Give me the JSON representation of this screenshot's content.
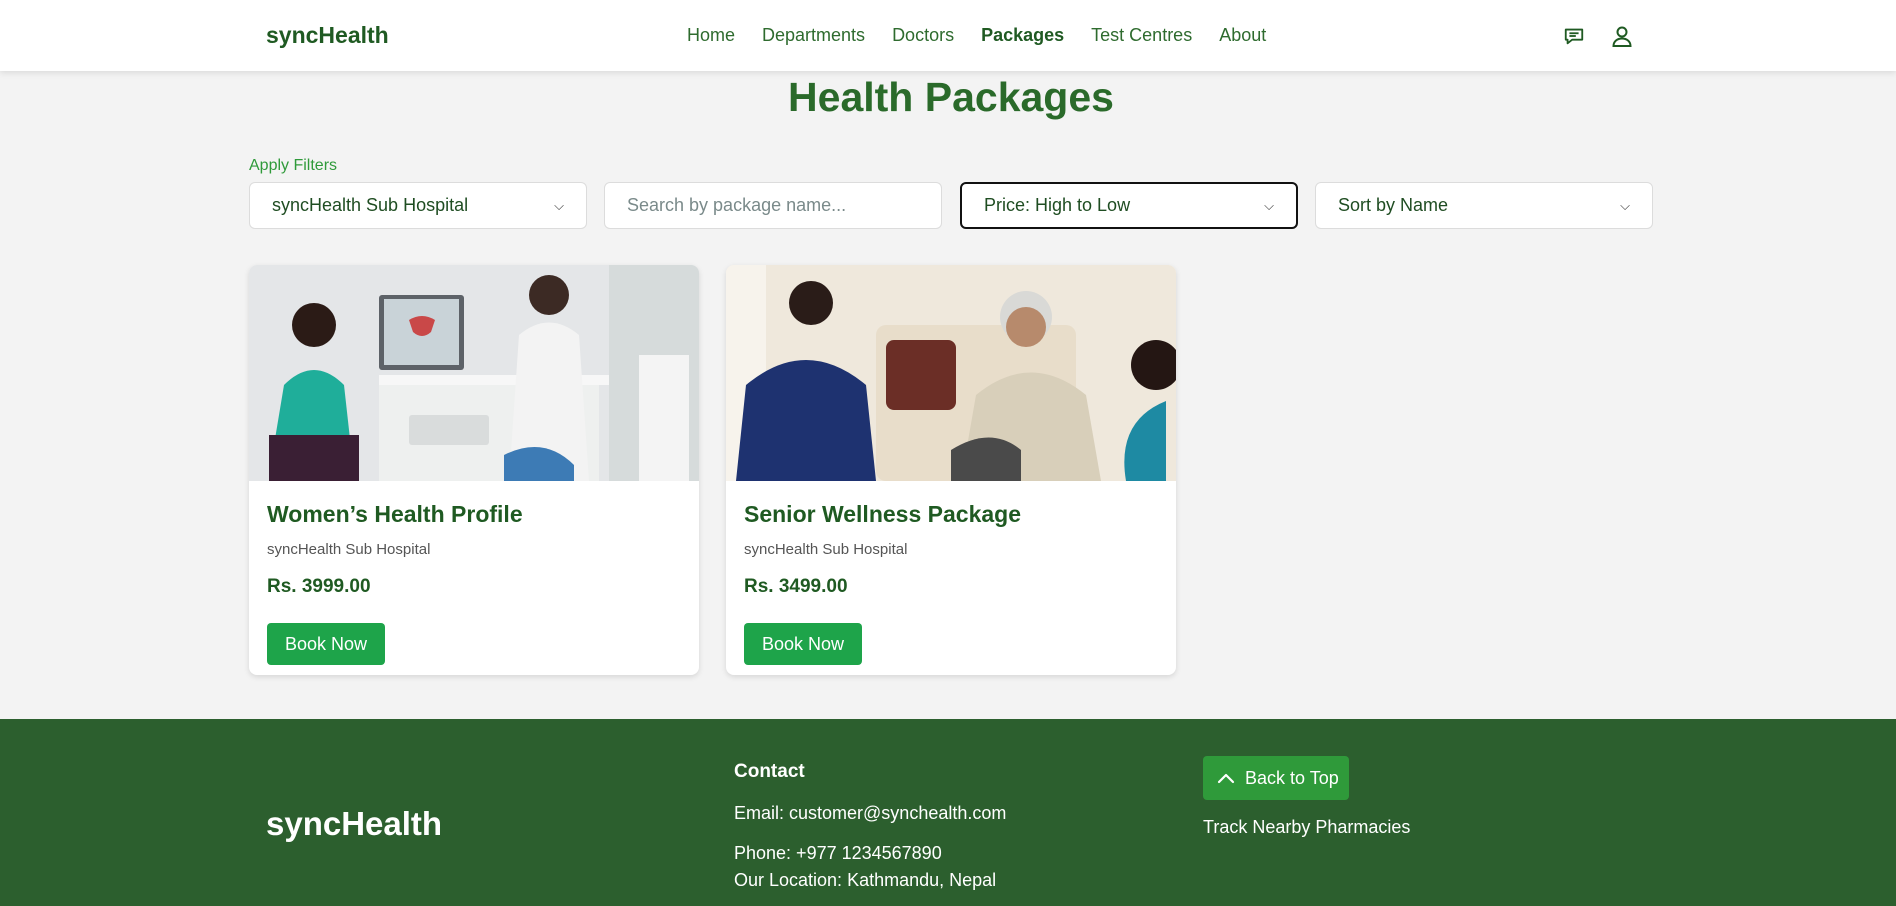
{
  "nav": {
    "brand": "syncHealth",
    "links": [
      "Home",
      "Departments",
      "Doctors",
      "Packages",
      "Test Centres",
      "About"
    ],
    "active_link": "Packages",
    "icons": [
      "chat-icon",
      "user-icon"
    ]
  },
  "page": {
    "title": "Health Packages"
  },
  "filters": {
    "label": "Apply Filters",
    "hospital": "syncHealth Sub Hospital",
    "search_placeholder": "Search by package name...",
    "price_sort": "Price: High to Low",
    "name_sort": "Sort by Name"
  },
  "packages": [
    {
      "title": "Women’s Health Profile",
      "hospital": "syncHealth Sub Hospital",
      "price": "Rs. 3999.00",
      "button": "Book Now"
    },
    {
      "title": "Senior Wellness Package",
      "hospital": "syncHealth Sub Hospital",
      "price": "Rs. 3499.00",
      "button": "Book Now"
    }
  ],
  "footer": {
    "brand": "syncHealth",
    "contact_title": "Contact",
    "email": "Email: customer@synchealth.com",
    "phone": "Phone: +977 1234567890",
    "location": "Our Location: Kathmandu, Nepal",
    "back_to_top": "Back to Top",
    "pharmacies": "Track Nearby Pharmacies"
  },
  "colors": {
    "brand_green": "#1f5a22",
    "button_green": "#1ea44a",
    "footer_green": "#2c5f2e"
  }
}
